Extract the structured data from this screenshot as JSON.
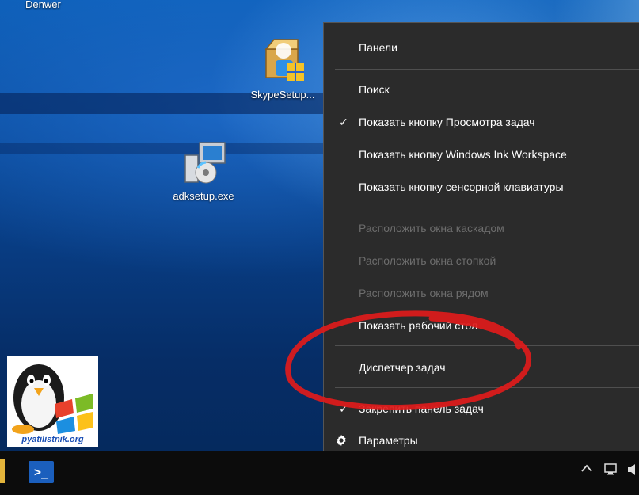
{
  "desktop": {
    "top_label": "Denwer",
    "icons": [
      {
        "label": "SkypeSetup..."
      },
      {
        "label": "adksetup.exe"
      }
    ],
    "logo_text": "pyatilistnik.org"
  },
  "context_menu": {
    "items": [
      {
        "label": "Панели",
        "enabled": true
      },
      {
        "label": "Поиск",
        "enabled": true
      },
      {
        "label": "Показать кнопку Просмотра задач",
        "enabled": true,
        "checked": true
      },
      {
        "label": "Показать кнопку Windows Ink Workspace",
        "enabled": true
      },
      {
        "label": "Показать кнопку сенсорной клавиатуры",
        "enabled": true
      },
      {
        "label": "Расположить окна каскадом",
        "enabled": false
      },
      {
        "label": "Расположить окна стопкой",
        "enabled": false
      },
      {
        "label": "Расположить окна рядом",
        "enabled": false
      },
      {
        "label": "Показать рабочий стол",
        "enabled": true
      },
      {
        "label": "Диспетчер задач",
        "enabled": true
      },
      {
        "label": "Закрепить панель задач",
        "enabled": true,
        "checked": true
      },
      {
        "label": "Параметры",
        "enabled": true,
        "icon": "gear-icon"
      }
    ]
  },
  "taskbar": {
    "powershell_glyph": ">_"
  },
  "colors": {
    "menu_bg": "#2b2b2b",
    "menu_text": "#ffffff",
    "menu_disabled": "#6d6d6d",
    "highlight_circle": "#e01b1b"
  }
}
